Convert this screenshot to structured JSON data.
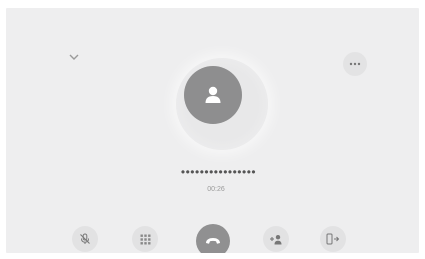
{
  "call": {
    "number": "••••••••••••••••",
    "duration": "00:26"
  },
  "icons": {
    "collapse": "chevron-down-icon",
    "more": "more-options-icon",
    "avatar": "contact-person-icon",
    "mute": "microphone-muted-icon",
    "keypad": "dialpad-icon",
    "end_call": "end-call-icon",
    "add_call": "add-participant-icon",
    "transfer": "transfer-to-handset-icon"
  },
  "colors": {
    "screen_background": "#eeeeef",
    "avatar": "#8e8e8f",
    "end_call_button": "#909091",
    "control_button": "#e2e2e3"
  }
}
